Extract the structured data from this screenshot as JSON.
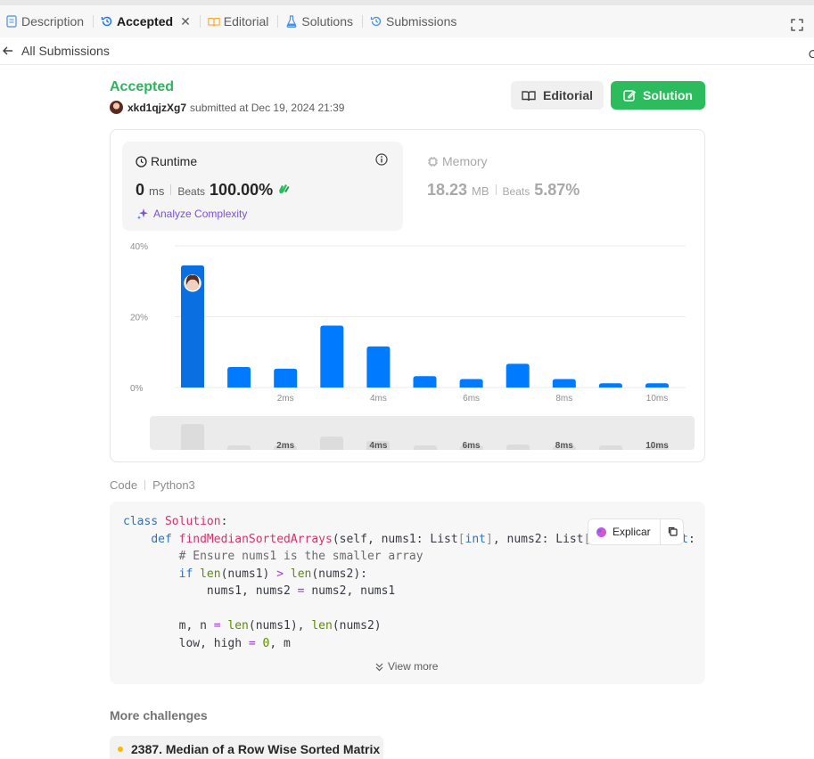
{
  "tabs": [
    {
      "label": "Description",
      "icon": "description-icon",
      "active": false
    },
    {
      "label": "Accepted",
      "icon": "history-icon",
      "active": true
    },
    {
      "label": "Editorial",
      "icon": "book-icon",
      "active": false
    },
    {
      "label": "Solutions",
      "icon": "flask-icon",
      "active": false
    },
    {
      "label": "Submissions",
      "icon": "history-icon",
      "active": false
    }
  ],
  "back": {
    "label": "All Submissions"
  },
  "submission": {
    "status": "Accepted",
    "username": "xkd1qjzXg7",
    "submitted_text": "submitted at Dec 19, 2024 21:39"
  },
  "buttons": {
    "editorial": "Editorial",
    "solution": "Solution"
  },
  "runtime": {
    "title": "Runtime",
    "value": "0",
    "unit": "ms",
    "beats_label": "Beats",
    "beats_value": "100.00%",
    "analyze": "Analyze Complexity"
  },
  "memory": {
    "title": "Memory",
    "value": "18.23",
    "unit": "MB",
    "beats_label": "Beats",
    "beats_value": "5.87%"
  },
  "chart_data": {
    "type": "bar",
    "x": [
      0,
      1,
      2,
      3,
      4,
      5,
      6,
      7,
      8,
      9,
      10
    ],
    "values": [
      34.5,
      5.8,
      5.3,
      17.5,
      11.6,
      3.2,
      2.4,
      6.7,
      2.4,
      1.2,
      1.2
    ],
    "highlight_index": 0,
    "y_ticks": [
      "40%",
      "20%",
      "0%"
    ],
    "ylim": [
      0,
      40
    ],
    "x_ticks": [
      {
        "x": 2,
        "label": "2ms"
      },
      {
        "x": 4,
        "label": "4ms"
      },
      {
        "x": 6,
        "label": "6ms"
      },
      {
        "x": 8,
        "label": "8ms"
      },
      {
        "x": 10,
        "label": "10ms"
      }
    ],
    "grid": true,
    "bar_color": "#007aff",
    "highlight_color": "#0a6fe0"
  },
  "code": {
    "header": "Code",
    "language": "Python3",
    "explain": "Explicar",
    "view_more": "View more"
  },
  "more": {
    "title": "More challenges",
    "items": [
      {
        "label": "2387. Median of a Row Wise Sorted Matrix",
        "difficulty_color": "#ffb800"
      }
    ]
  },
  "colors": {
    "accent_green": "#2cbb5d",
    "status_green": "#2db55d",
    "purple": "#7a52d9"
  }
}
